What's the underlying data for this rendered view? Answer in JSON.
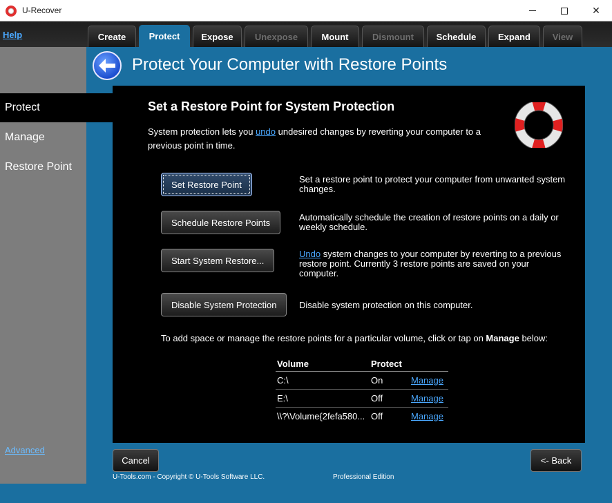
{
  "window": {
    "title": "U-Recover",
    "min_icon": "minimize-icon",
    "max_icon": "maximize-icon",
    "close_glyph": "✕"
  },
  "help_label": "Help",
  "tabs": [
    {
      "label": "Create",
      "state": "normal"
    },
    {
      "label": "Protect",
      "state": "active"
    },
    {
      "label": "Expose",
      "state": "normal"
    },
    {
      "label": "Unexpose",
      "state": "disabled"
    },
    {
      "label": "Mount",
      "state": "normal"
    },
    {
      "label": "Dismount",
      "state": "disabled"
    },
    {
      "label": "Schedule",
      "state": "normal"
    },
    {
      "label": "Expand",
      "state": "normal"
    },
    {
      "label": "View",
      "state": "disabled"
    }
  ],
  "sidebar": {
    "items": [
      {
        "label": "Protect",
        "active": true
      },
      {
        "label": "Manage",
        "active": false
      },
      {
        "label": "Restore Point",
        "active": false
      }
    ],
    "advanced_label": "Advanced"
  },
  "header": {
    "title": "Protect Your Computer with Restore Points",
    "back_icon": "back-arrow-icon"
  },
  "panel": {
    "title": "Set a Restore Point for System Protection",
    "intro_pre": "System protection lets you ",
    "intro_link": "undo",
    "intro_post": " undesired changes by reverting your computer to a previous point in time.",
    "actions": [
      {
        "button": "Set Restore Point",
        "desc": "Set a restore point to protect your computer from unwanted system changes."
      },
      {
        "button": "Schedule Restore Points",
        "desc": "Automatically schedule the creation of restore points on a daily or weekly schedule."
      },
      {
        "button": "Start System Restore...",
        "desc_link": "Undo",
        "desc": " system changes to your computer by reverting to a previous restore point. Currently 3 restore points are saved on your computer."
      },
      {
        "button": "Disable System Protection",
        "desc": "Disable system protection on this computer."
      }
    ],
    "manage_note_pre": "To add space or manage the restore points for a particular volume, click or tap on ",
    "manage_note_bold": "Manage",
    "manage_note_post": " below:",
    "table": {
      "headers": [
        "Volume",
        "Protect"
      ],
      "rows": [
        {
          "volume": "C:\\",
          "protect": "On",
          "action": "Manage"
        },
        {
          "volume": "E:\\",
          "protect": "Off",
          "action": "Manage"
        },
        {
          "volume": "\\\\?\\Volume{2fefa580...",
          "protect": "Off",
          "action": "Manage"
        }
      ]
    }
  },
  "footer": {
    "cancel_label": "Cancel",
    "back_label": "<- Back",
    "copyright": "U-Tools.com - Copyright © U-Tools Software LLC.",
    "edition": "Professional Edition"
  },
  "colors": {
    "accent": "#1a6fa0",
    "sidebar": "#7d7d7d",
    "link": "#4aa8ff"
  }
}
